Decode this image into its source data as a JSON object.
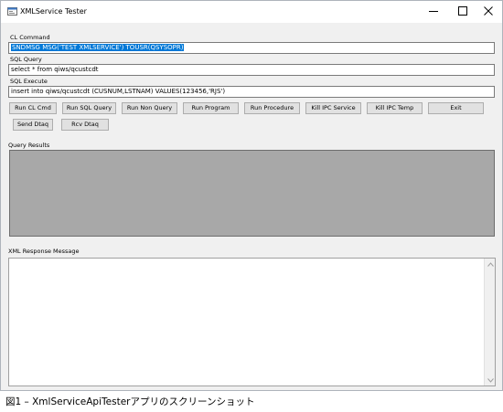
{
  "window": {
    "title": "XMLService Tester",
    "controls": [
      "minimize-icon",
      "maximize-icon",
      "close-icon"
    ]
  },
  "cl_command": {
    "label": "CL Command",
    "value": "SNDMSG MSG('TEST XMLSERVICE') TOUSR(QSYSOPR)"
  },
  "sql_query": {
    "label": "SQL Query",
    "value": "select * from qiws/qcustcdt"
  },
  "sql_execute": {
    "label": "SQL Execute",
    "value": "insert into qiws/qcustcdt  (CUSNUM,LSTNAM) VALUES(123456,'RJS')"
  },
  "buttons": {
    "run_cl_cmd": "Run CL Cmd",
    "run_sql_query": "Run SQL Query",
    "run_non_query": "Run Non Query",
    "run_program": "Run Program",
    "run_procedure": "Run Procedure",
    "kill_ipc_service": "Kill IPC Service",
    "kill_ipc_temp": "Kill IPC Temp",
    "exit": "Exit",
    "send_dtaq": "Send Dtaq",
    "rcv_dtaq": "Rcv Dtaq"
  },
  "query_results": {
    "label": "Query Results"
  },
  "xml_response": {
    "label": "XML Response Message",
    "value": ""
  },
  "caption": "図1 – XmlServiceApiTesterアプリのスクリーンショット"
}
